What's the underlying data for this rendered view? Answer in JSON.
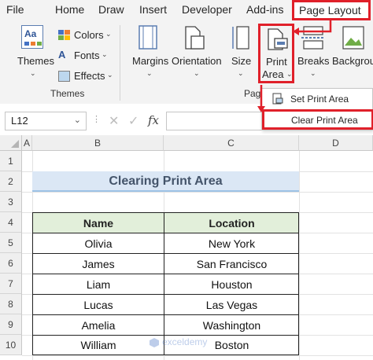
{
  "menu": {
    "file": "File",
    "home": "Home",
    "draw": "Draw",
    "insert": "Insert",
    "developer": "Developer",
    "addins": "Add-ins",
    "page_layout": "Page Layout"
  },
  "ribbon": {
    "themes": {
      "themes_label": "Themes",
      "colors": "Colors",
      "fonts": "Fonts",
      "effects": "Effects",
      "group_label": "Themes"
    },
    "page_setup": {
      "margins": "Margins",
      "orientation": "Orientation",
      "size": "Size",
      "print_area_line1": "Print",
      "print_area_line2": "Area",
      "breaks": "Breaks",
      "background": "Backgrou",
      "group_label_partial": "Pag"
    }
  },
  "print_area_menu": {
    "set": "Set Print Area",
    "clear": "Clear Print Area"
  },
  "formula_bar": {
    "name_box": "L12",
    "cancel_glyph": "✕",
    "enter_glyph": "✓",
    "fx": "fx",
    "value": ""
  },
  "columns": [
    "A",
    "B",
    "C",
    "D"
  ],
  "rows": [
    "1",
    "2",
    "3",
    "4",
    "5",
    "6",
    "7",
    "8",
    "9",
    "10"
  ],
  "sheet": {
    "title": "Clearing Print Area",
    "headers": [
      "Name",
      "Location"
    ],
    "data": [
      [
        "Olivia",
        "New York"
      ],
      [
        "James",
        "San Francisco"
      ],
      [
        "Liam",
        "Houston"
      ],
      [
        "Lucas",
        "Las Vegas"
      ],
      [
        "Amelia",
        "Washington"
      ],
      [
        "William",
        "Boston"
      ]
    ]
  },
  "watermark": "exceldemy",
  "colors": {
    "highlight_red": "#e0202a",
    "title_fill": "#dbe7f5",
    "title_text": "#44546a",
    "header_fill": "#e2efda"
  }
}
